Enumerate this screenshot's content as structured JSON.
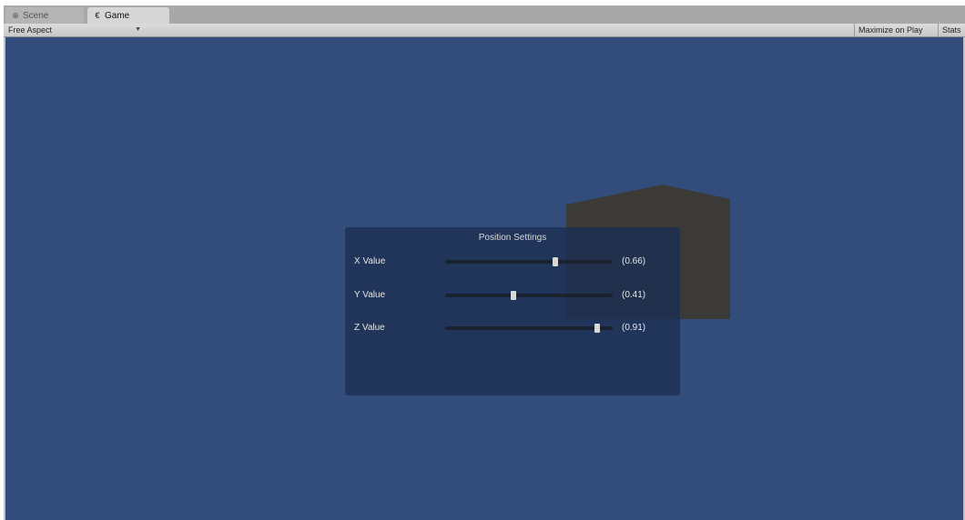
{
  "tabs": [
    {
      "label": "Scene",
      "icon": "scene-icon",
      "glyph": "⊕",
      "active": false
    },
    {
      "label": "Game",
      "icon": "game-icon",
      "glyph": "€",
      "active": true
    }
  ],
  "toolbar": {
    "aspect_label": "Free Aspect",
    "maximize_label": "Maximize on Play",
    "stats_label": "Stats"
  },
  "panel": {
    "title": "Position Settings",
    "sliders": [
      {
        "label": "X Value",
        "value": 0.66,
        "display": "(0.66)"
      },
      {
        "label": "Y Value",
        "value": 0.41,
        "display": "(0.41)"
      },
      {
        "label": "Z Value",
        "value": 0.91,
        "display": "(0.91)"
      }
    ]
  },
  "colors": {
    "viewport": "#324d7c",
    "panel": "#1c3052",
    "cube": "#3b3a37"
  }
}
